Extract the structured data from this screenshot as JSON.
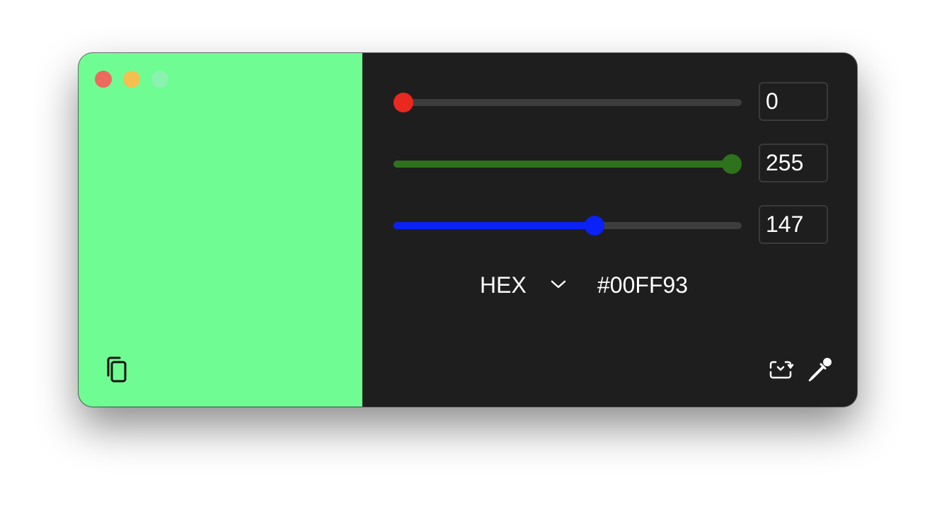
{
  "window": {
    "title": "",
    "traffic_lights": [
      "close",
      "minimize",
      "zoom"
    ]
  },
  "preview": {
    "color": "#6ffd93",
    "copy_icon": "copy-icon"
  },
  "sliders": [
    {
      "channel": "red",
      "value": 0,
      "max": 255,
      "fill_color": "#3d3d3d",
      "thumb_color": "#e9281f"
    },
    {
      "channel": "green",
      "value": 255,
      "max": 255,
      "fill_color": "#2f721c",
      "thumb_color": "#2f721c"
    },
    {
      "channel": "blue",
      "value": 147,
      "max": 255,
      "fill_color": "#0a22f5",
      "thumb_color": "#0a22f5"
    }
  ],
  "inputs": {
    "red": "0",
    "green": "255",
    "blue": "147"
  },
  "format": {
    "label": "HEX",
    "value": "#00FF93"
  },
  "toolbar": {
    "swap_icon": "swap-icon",
    "eyedropper_icon": "eyedropper-icon"
  }
}
